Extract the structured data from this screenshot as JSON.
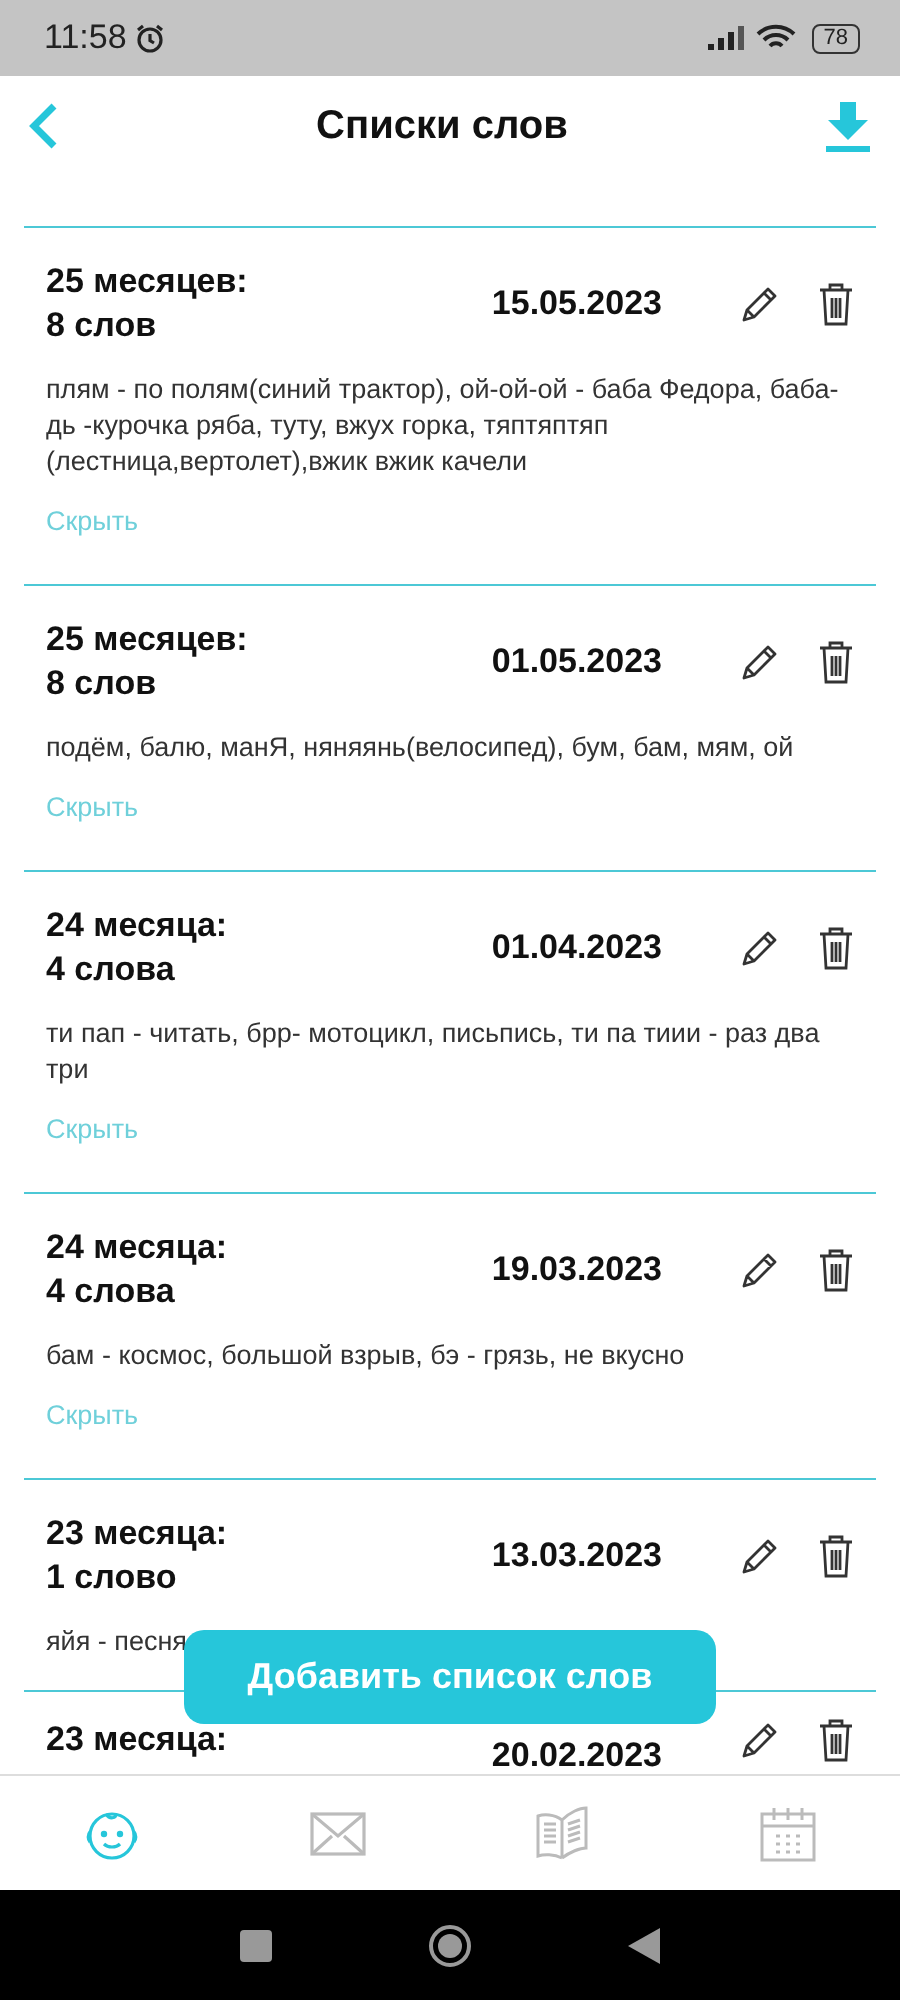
{
  "status_bar": {
    "time": "11:58",
    "battery": "78"
  },
  "header": {
    "title": "Списки слов"
  },
  "lists": [
    {
      "age": "25 месяцев:",
      "count": "8 слов",
      "date": "15.05.2023",
      "words": "плям - по полям(синий трактор), ой-ой-ой - баба Федора, баба-дь -курочка ряба, туту, вжух горка, тяптяптяп (лестница,вертолет),вжик вжик качели",
      "hide": "Скрыть"
    },
    {
      "age": "25 месяцев:",
      "count": "8 слов",
      "date": "01.05.2023",
      "words": "подём, балю, манЯ, няняянь(велосипед), бум, бам, мям, ой",
      "hide": "Скрыть"
    },
    {
      "age": "24 месяца:",
      "count": "4 слова",
      "date": "01.04.2023",
      "words": "ти пап - читать, брр- мотоцикл, письпись, ти па тиии - раз два три",
      "hide": "Скрыть"
    },
    {
      "age": "24 месяца:",
      "count": "4 слова",
      "date": "19.03.2023",
      "words": "бам - космос, большой взрыв, бэ - грязь, не вкусно",
      "hide": "Скрыть"
    },
    {
      "age": "23 месяца:",
      "count": "1 слово",
      "date": "13.03.2023",
      "words": "яйя - песня"
    },
    {
      "age": "23 месяца:",
      "date": "20.02.2023"
    }
  ],
  "add_button": "Добавить список слов",
  "bottom_nav": [
    {
      "kind": "baby",
      "selected": true
    },
    {
      "kind": "mail",
      "selected": false
    },
    {
      "kind": "book",
      "selected": false
    },
    {
      "kind": "calendar",
      "selected": false
    }
  ]
}
